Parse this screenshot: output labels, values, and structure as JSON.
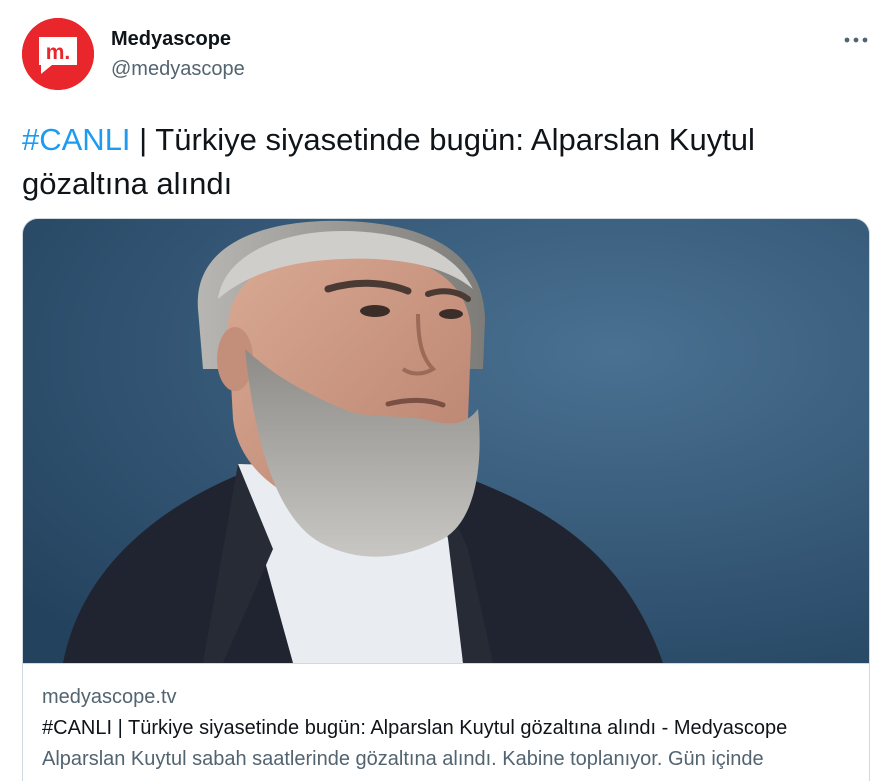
{
  "author": {
    "name": "Medyascope",
    "handle": "@medyascope",
    "avatar_letter": "m.",
    "avatar_icon": "medyascope-logo-icon"
  },
  "tweet": {
    "hashtag": "#CANLI",
    "text": " | Türkiye siyasetinde bugün: Alparslan Kuytul gözaltına alındı"
  },
  "menu_icon": "more-horizontal-icon",
  "card": {
    "domain": "medyascope.tv",
    "title": "#CANLI | Türkiye siyasetinde bugün: Alparslan Kuytul gözaltına alındı - Medyascope",
    "description": "Alparslan Kuytul sabah saatlerinde gözaltına alındı. Kabine toplanıyor. Gün içinde"
  },
  "colors": {
    "brand_red": "#e8262b",
    "link_blue": "#1d9bf0",
    "secondary_text": "#536471",
    "primary_text": "#0f1419"
  }
}
